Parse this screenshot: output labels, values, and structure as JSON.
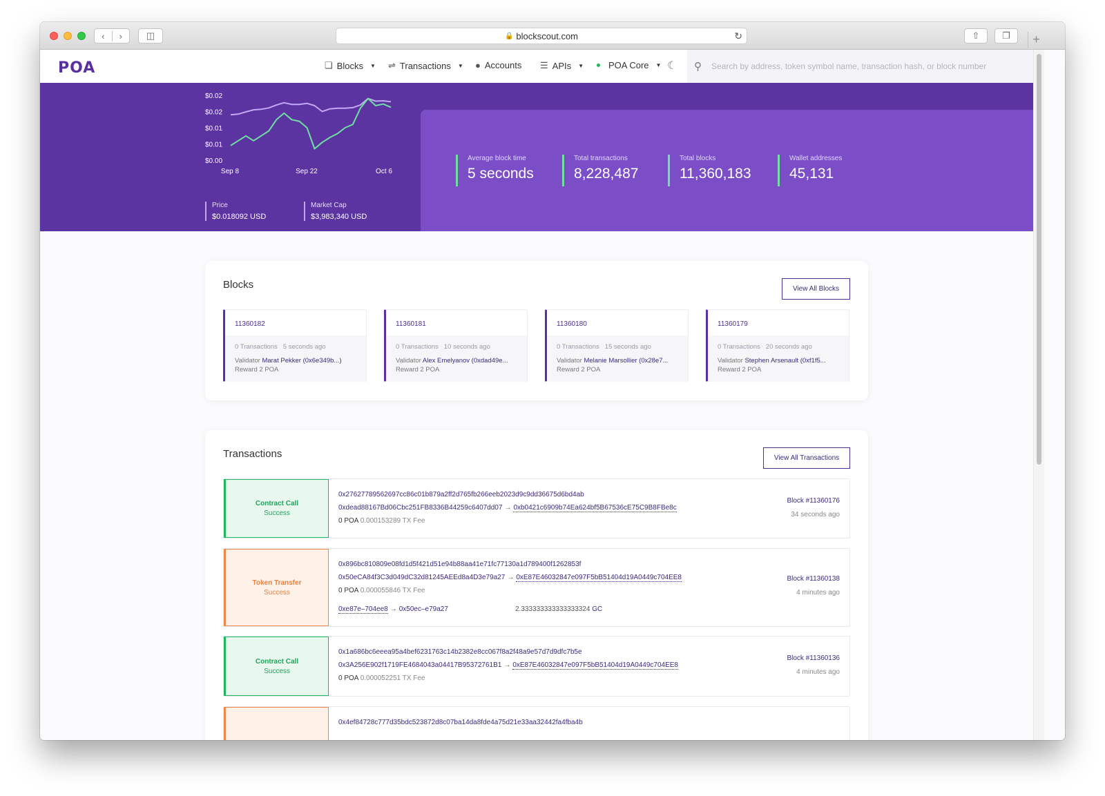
{
  "browser": {
    "url": "blockscout.com"
  },
  "nav": {
    "logo": "POA",
    "blocks": "Blocks",
    "transactions": "Transactions",
    "accounts": "Accounts",
    "apis": "APIs",
    "network": "POA Core",
    "search_placeholder": "Search by address, token symbol name, transaction hash, or block number"
  },
  "chart_data": {
    "type": "line",
    "title": "",
    "xlabel": "",
    "ylabel": "",
    "x_ticks": [
      "Sep 8",
      "Sep 22",
      "Oct 6"
    ],
    "y_ticks": [
      "$0.02",
      "$0.02",
      "$0.01",
      "$0.01",
      "$0.00"
    ],
    "series": [
      {
        "color": "#c3a9f5",
        "values": [
          0.014,
          0.0142,
          0.0149,
          0.0155,
          0.0157,
          0.0161,
          0.017,
          0.0177,
          0.0172,
          0.0172,
          0.0175,
          0.0168,
          0.015,
          0.0158,
          0.016,
          0.016,
          0.0162,
          0.017,
          0.019,
          0.0182,
          0.0183,
          0.018
        ]
      },
      {
        "color": "#6fe0a2",
        "values": [
          0.0045,
          0.006,
          0.0075,
          0.006,
          0.0075,
          0.009,
          0.0125,
          0.0145,
          0.0125,
          0.012,
          0.01,
          0.0035,
          0.0055,
          0.007,
          0.0082,
          0.01,
          0.011,
          0.016,
          0.019,
          0.0168,
          0.0173,
          0.0163
        ]
      }
    ],
    "ylim": [
      0.0,
      0.02
    ]
  },
  "hero": {
    "price_label": "Price",
    "price_value": "$0.018092 USD",
    "cap_label": "Market Cap",
    "cap_value": "$3,983,340 USD",
    "stats": [
      {
        "label": "Average block time",
        "value": "5 seconds"
      },
      {
        "label": "Total transactions",
        "value": "8,228,487"
      },
      {
        "label": "Total blocks",
        "value": "11,360,183"
      },
      {
        "label": "Wallet addresses",
        "value": "45,131"
      }
    ]
  },
  "blocks": {
    "title": "Blocks",
    "view_all": "View All Blocks",
    "items": [
      {
        "number": "11360182",
        "tx": "0 Transactions",
        "ago": "5 seconds ago",
        "validator_label": "Validator",
        "validator": "Marat Pekker (0x6e349b...)",
        "reward": "Reward 2 POA"
      },
      {
        "number": "11360181",
        "tx": "0 Transactions",
        "ago": "10 seconds ago",
        "validator_label": "Validator",
        "validator": "Alex Emelyanov (0xdad49e...",
        "reward": "Reward 2 POA"
      },
      {
        "number": "11360180",
        "tx": "0 Transactions",
        "ago": "15 seconds ago",
        "validator_label": "Validator",
        "validator": "Melanie Marsollier (0x28e7...",
        "reward": "Reward 2 POA"
      },
      {
        "number": "11360179",
        "tx": "0 Transactions",
        "ago": "20 seconds ago",
        "validator_label": "Validator",
        "validator": "Stephen Arsenault (0xf1f5...",
        "reward": "Reward 2 POA"
      }
    ]
  },
  "transactions": {
    "title": "Transactions",
    "view_all": "View All Transactions",
    "items": [
      {
        "type": "Contract Call",
        "status": "Success",
        "hash": "0x27627789562697cc86c01b879a2ff2d765fb266eeb2023d9c9dd36675d6bd4ab",
        "from": "0xdead88167Bd06Cbc251FB8336B44259c6407dd07",
        "to": "0xb0421c6909b74Ea624bf5B67536cE75C9B8FBe8c",
        "value": "0 POA",
        "fee": "0.000153289 TX Fee",
        "block": "Block #11360176",
        "ago": "34 seconds ago"
      },
      {
        "type": "Token Transfer",
        "status": "Success",
        "hash": "0x896bc810809e08fd1d5f421d51e94b88aa41e71fc77130a1d789400f1262853f",
        "from": "0x50eCA84f3C3d049dC32d81245AEEd8a4D3e79a27",
        "to": "0xE87E46032847e097F5bB51404d19A0449c704EE8",
        "value": "0 POA",
        "fee": "0.000055846 TX Fee",
        "token_from": "0xe87e–704ee8",
        "token_to": "0x50ec–e79a27",
        "token_amount": "2.333333333333333324",
        "token_symbol": "GC",
        "block": "Block #11360138",
        "ago": "4 minutes ago"
      },
      {
        "type": "Contract Call",
        "status": "Success",
        "hash": "0x1a686bc6eeea95a4bef6231763c14b2382e8cc067f8a2f48a9e57d7d9dfc7b5e",
        "from": "0x3A256E902f1719FE4684043a04417B95372761B1",
        "to": "0xE87E46032847e097F5bB51404d19A0449c704EE8",
        "value": "0 POA",
        "fee": "0.000052251 TX Fee",
        "block": "Block #11360136",
        "ago": "4 minutes ago"
      },
      {
        "hash": "0x4ef84728c777d35bdc523872d8c07ba14da8fde4a75d21e33aa32442fa4fba4b"
      }
    ]
  }
}
